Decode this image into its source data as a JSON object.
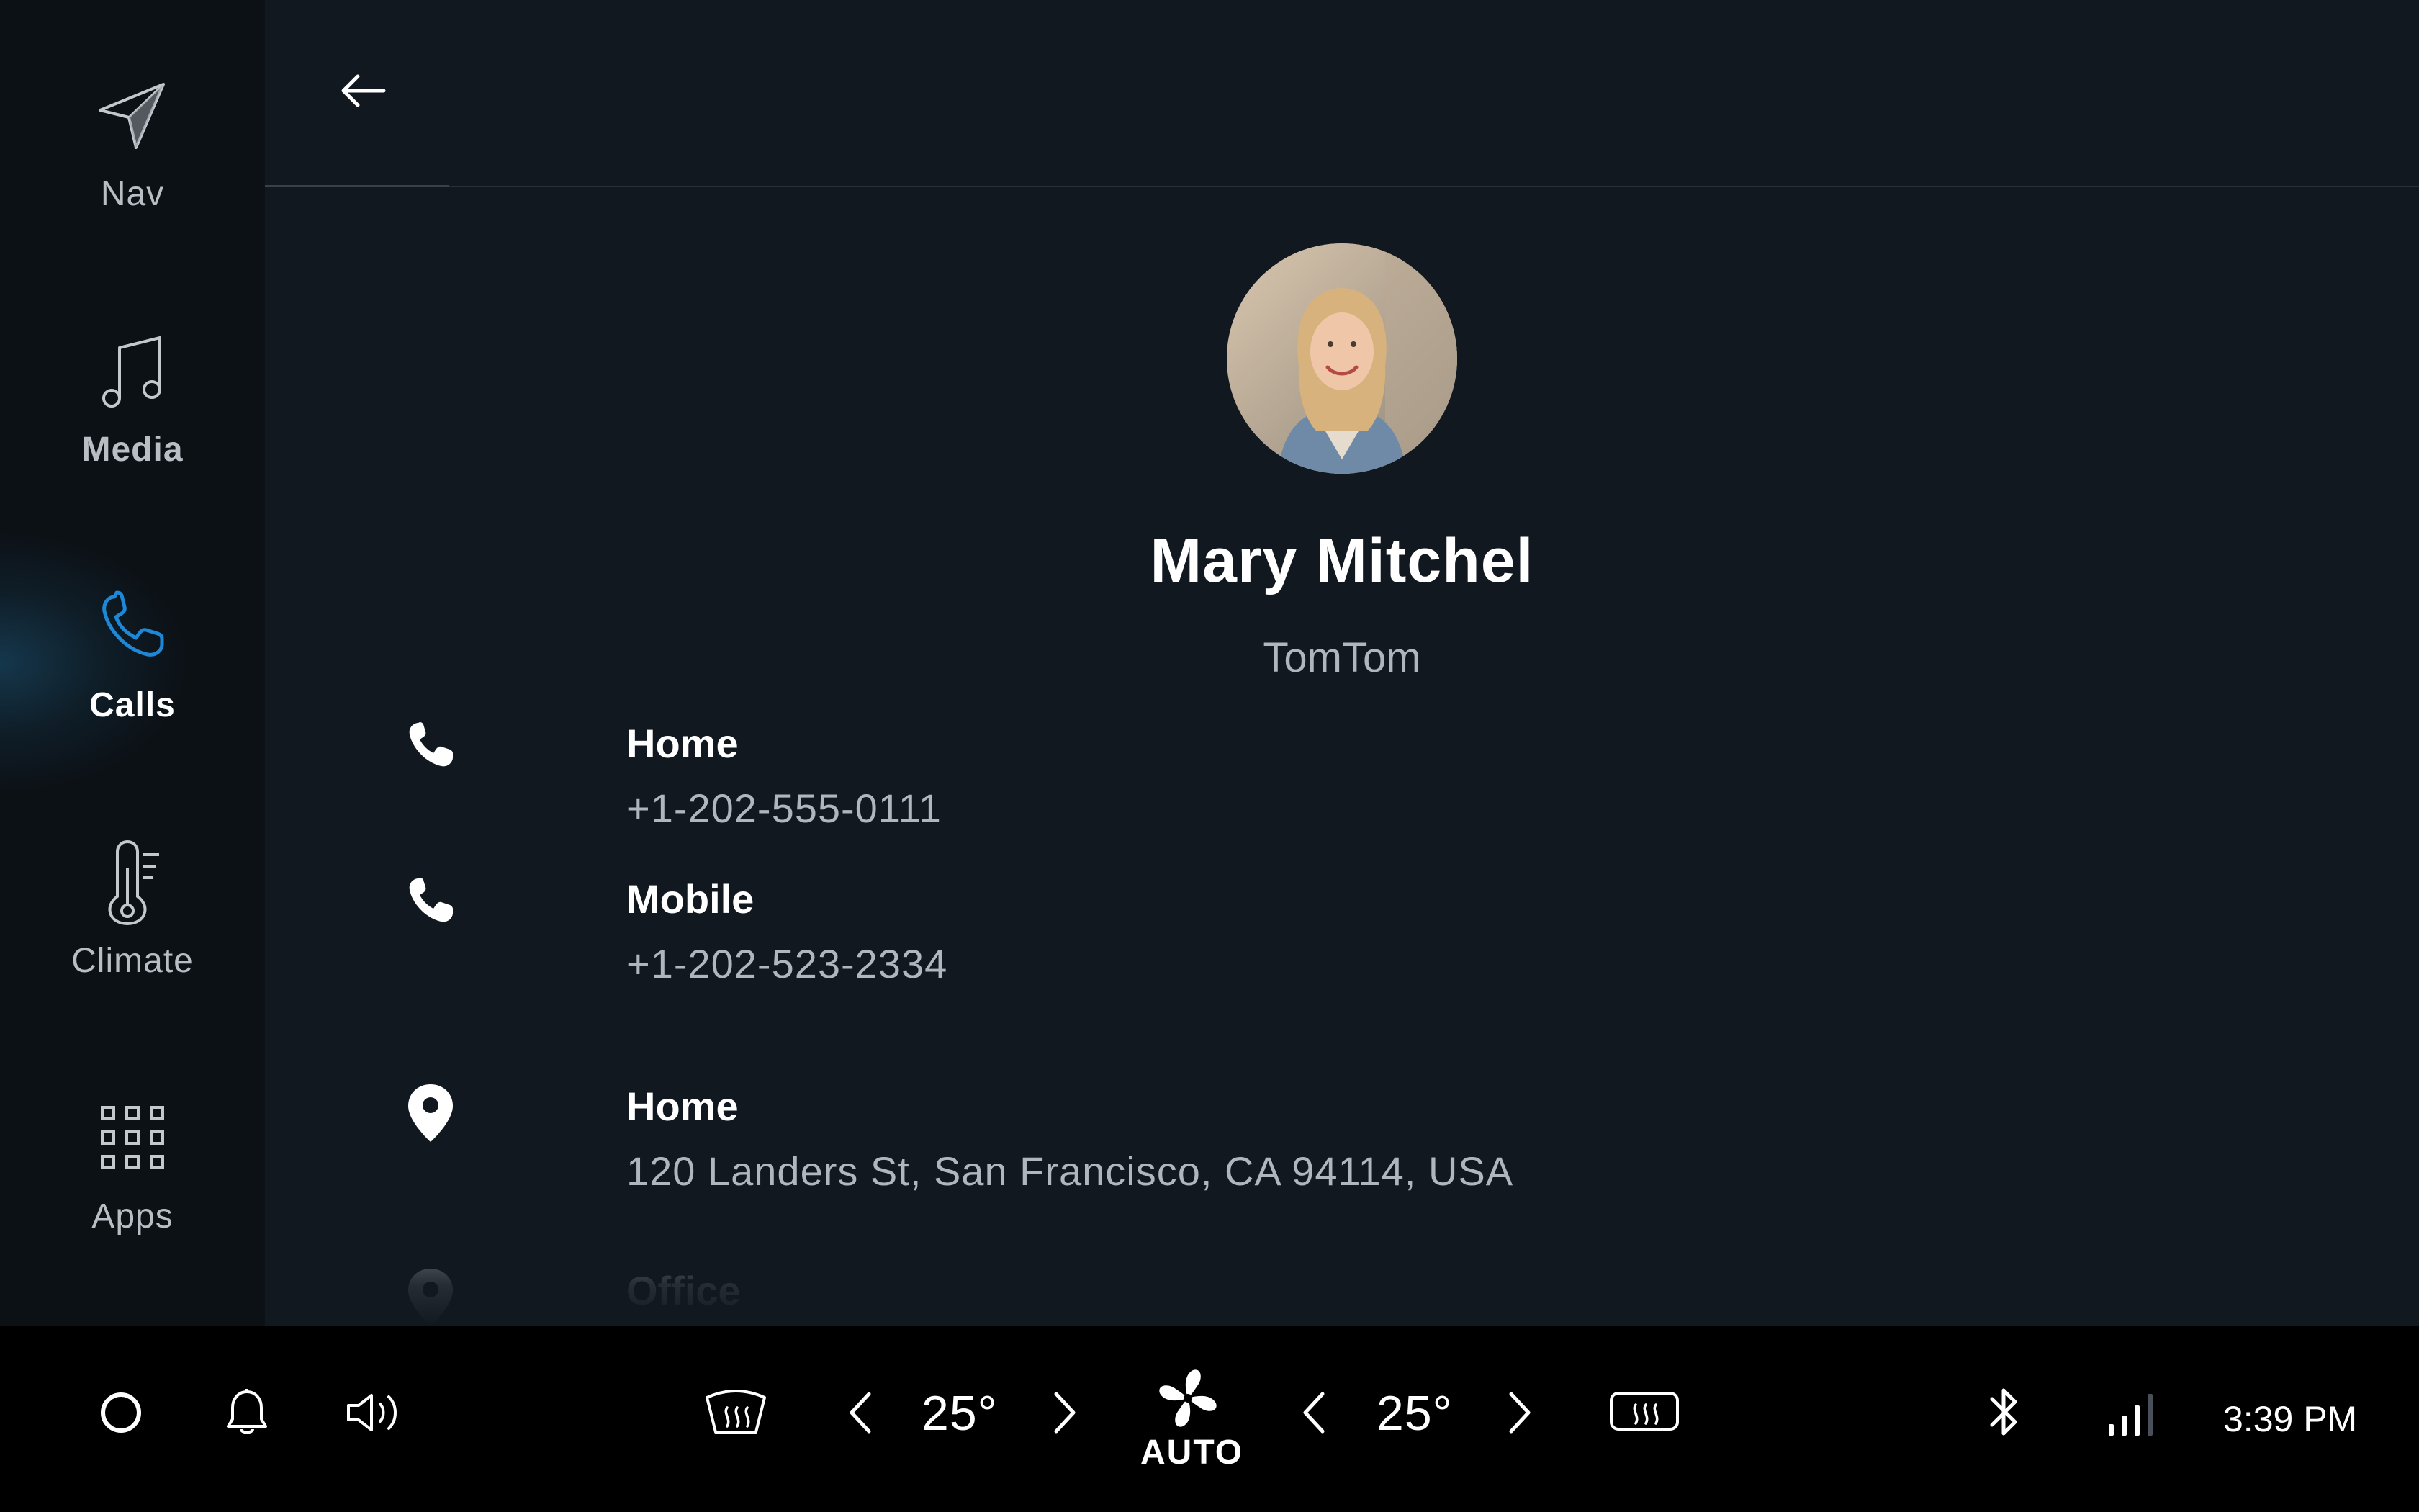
{
  "sidebar": {
    "items": [
      {
        "label": "Nav",
        "icon": "navigation-arrow-icon",
        "active": false
      },
      {
        "label": "Media",
        "icon": "music-note-icon",
        "active": false
      },
      {
        "label": "Calls",
        "icon": "phone-icon",
        "active": true
      },
      {
        "label": "Climate",
        "icon": "thermometer-icon",
        "active": false
      },
      {
        "label": "Apps",
        "icon": "grid-icon",
        "active": false
      }
    ]
  },
  "header": {
    "back_icon": "arrow-left-icon"
  },
  "contact": {
    "name": "Mary Mitchel",
    "company": "TomTom",
    "phones": [
      {
        "label": "Home",
        "value": "+1-202-555-0111"
      },
      {
        "label": "Mobile",
        "value": "+1-202-523-2334"
      }
    ],
    "addresses": [
      {
        "label": "Home",
        "value": "120 Landers St, San Francisco, CA 94114, USA"
      },
      {
        "label": "Office",
        "value": ""
      }
    ]
  },
  "bottom_bar": {
    "left_temp": "25°",
    "right_temp": "25°",
    "fan_label": "AUTO",
    "clock": "3:39 PM"
  },
  "colors": {
    "background": "#121820",
    "sidebar": "#0c1116",
    "accent": "#1e88d8",
    "bottom_bar": "#000000",
    "muted_text": "#b0b6bd"
  }
}
